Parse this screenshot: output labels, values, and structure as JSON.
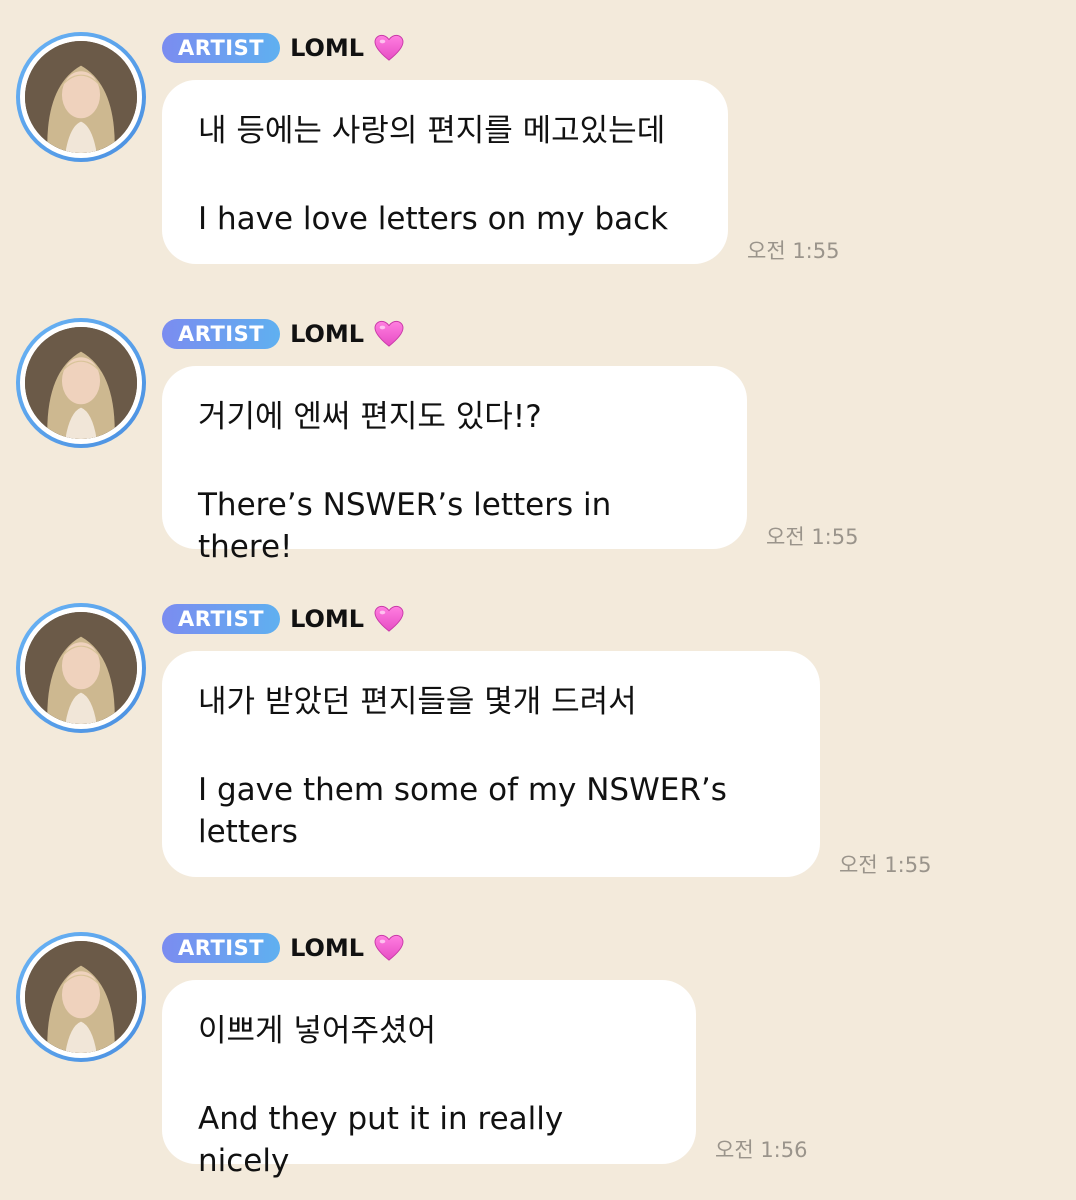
{
  "messages": [
    {
      "badge": "ARTIST",
      "sender": "LOML",
      "korean": "내 등에는 사랑의 편지를 메고있는데",
      "english": "I have love letters on my back",
      "time": "오전 1:55"
    },
    {
      "badge": "ARTIST",
      "sender": "LOML",
      "korean": "거기에 엔써 편지도 있다!?",
      "english": "There’s NSWER’s letters in there!",
      "time": "오전 1:55"
    },
    {
      "badge": "ARTIST",
      "sender": "LOML",
      "korean": "내가 받았던 편지들을 몇개 드려서",
      "english": "I gave them some of my NSWER’s\nletters",
      "time": "오전 1:55"
    },
    {
      "badge": "ARTIST",
      "sender": "LOML",
      "korean": "이쁘게 넣어주셨어",
      "english": "And they put it in really nicely",
      "time": "오전 1:56"
    }
  ],
  "colors": {
    "background": "#f3eadb",
    "bubble": "#ffffff",
    "badge_start": "#7b8cf0",
    "badge_end": "#5fb0f0",
    "avatar_ring": "#5aa2ec",
    "heart": "#f05bd0",
    "timestamp": "#9a948b"
  },
  "icons": {
    "heart": "pink-heart-icon",
    "avatar": "profile-avatar"
  }
}
